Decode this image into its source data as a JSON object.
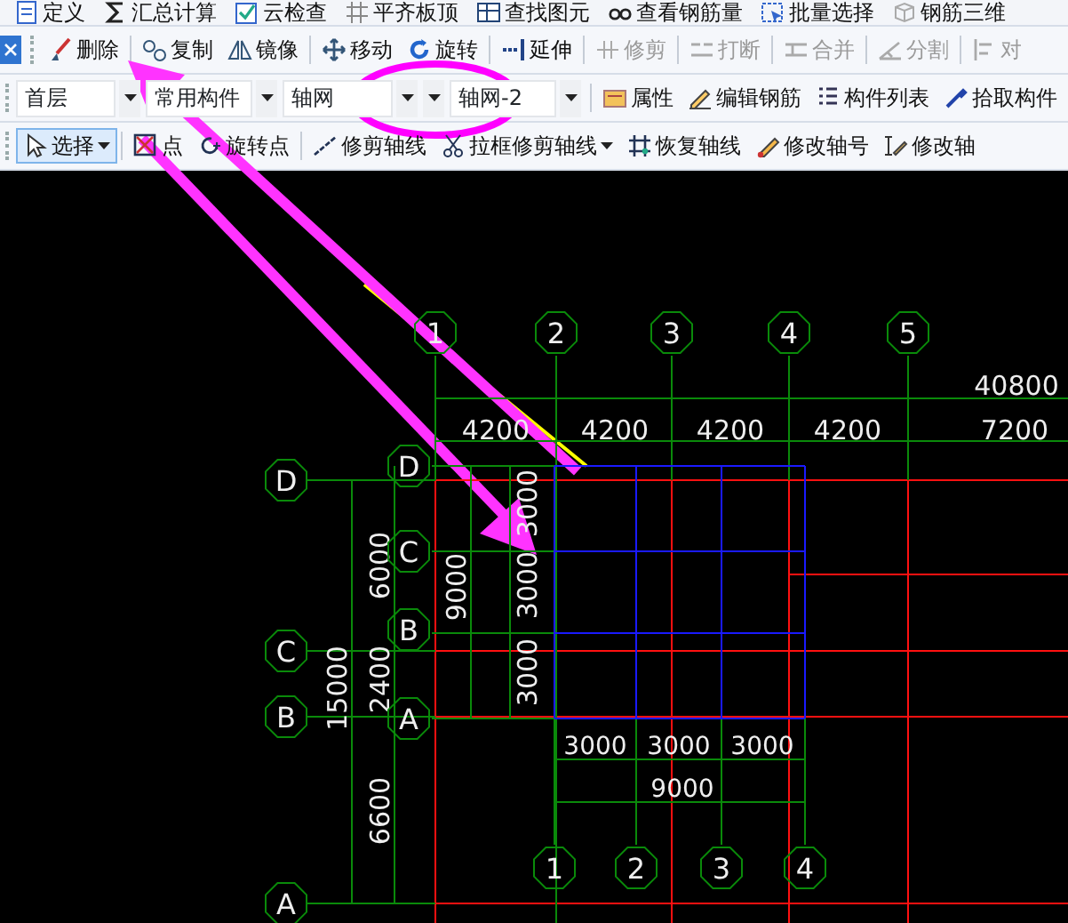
{
  "menu_toolbar": [
    {
      "label": "定义"
    },
    {
      "label": "汇总计算"
    },
    {
      "label": "云检查"
    },
    {
      "label": "平齐板顶"
    },
    {
      "label": "查找图元"
    },
    {
      "label": "查看钢筋量"
    },
    {
      "label": "批量选择"
    },
    {
      "label": "钢筋三维"
    }
  ],
  "edit_toolbar": [
    {
      "label": "删除",
      "disabled": false
    },
    {
      "label": "复制",
      "disabled": false
    },
    {
      "label": "镜像",
      "disabled": false
    },
    {
      "label": "移动",
      "disabled": false
    },
    {
      "label": "旋转",
      "disabled": false
    },
    {
      "label": "延伸",
      "disabled": false
    },
    {
      "label": "修剪",
      "disabled": true
    },
    {
      "label": "打断",
      "disabled": true
    },
    {
      "label": "合并",
      "disabled": true
    },
    {
      "label": "分割",
      "disabled": true
    },
    {
      "label": "对",
      "disabled": true
    }
  ],
  "selectors": [
    {
      "value": "首层"
    },
    {
      "value": "常用构件"
    },
    {
      "value": "轴网"
    },
    {
      "value": "轴网-2"
    }
  ],
  "component_toolbar": [
    {
      "label": "属性"
    },
    {
      "label": "编辑钢筋"
    },
    {
      "label": "构件列表"
    },
    {
      "label": "拾取构件"
    }
  ],
  "draw_toolbar": [
    {
      "label": "选择",
      "selected": true,
      "dropdown": true
    },
    {
      "label": "点",
      "selected": false,
      "dropdown": false
    },
    {
      "label": "旋转点",
      "selected": false,
      "dropdown": false
    },
    {
      "label": "修剪轴线",
      "selected": false,
      "dropdown": false
    },
    {
      "label": "拉框修剪轴线",
      "selected": false,
      "dropdown": true
    },
    {
      "label": "恢复轴线",
      "selected": false,
      "dropdown": false
    },
    {
      "label": "修改轴号",
      "selected": false,
      "dropdown": false
    },
    {
      "label": "修改轴",
      "selected": false,
      "dropdown": false
    }
  ],
  "drawing": {
    "axis_network_1": {
      "column_labels": [
        "1",
        "2",
        "3",
        "4",
        "5"
      ],
      "row_labels": [
        "D",
        "C",
        "B",
        "A"
      ],
      "total_dimension": "40800",
      "top_dimensions": [
        "4200",
        "4200",
        "4200",
        "4200",
        "7200"
      ],
      "side_total": "15000",
      "side_dimensions": [
        "6000",
        "2400",
        "6600"
      ]
    },
    "axis_network_2": {
      "row_labels": [
        "D",
        "C",
        "B",
        "A"
      ],
      "side_total": "9000",
      "side_dimensions": [
        "3000",
        "3000",
        "3000"
      ],
      "bottom_dimensions": [
        "3000",
        "3000",
        "3000"
      ],
      "bottom_total": "9000",
      "column_labels": [
        "1",
        "2",
        "3",
        "4"
      ]
    }
  }
}
